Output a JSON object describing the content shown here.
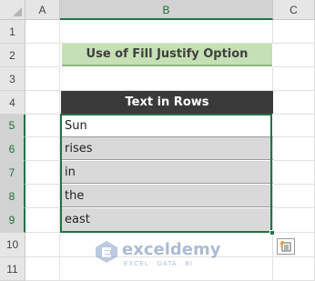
{
  "columns": [
    "A",
    "B",
    "C"
  ],
  "rows": [
    "1",
    "2",
    "3",
    "4",
    "5",
    "6",
    "7",
    "8",
    "9",
    "10",
    "11"
  ],
  "title": "Use of Fill Justify Option",
  "table": {
    "header": "Text in Rows",
    "cells": [
      "Sun",
      "rises",
      "in",
      "the",
      "east"
    ]
  },
  "watermark": {
    "name": "exceldemy",
    "tagline": "EXCEL · DATA · BI"
  },
  "colors": {
    "title_fill": "#c5e0b4",
    "header_fill": "#3a3a3a",
    "selection": "#217346"
  },
  "icons": [
    "flash-fill-options-icon",
    "exceldemy-logo-icon"
  ]
}
